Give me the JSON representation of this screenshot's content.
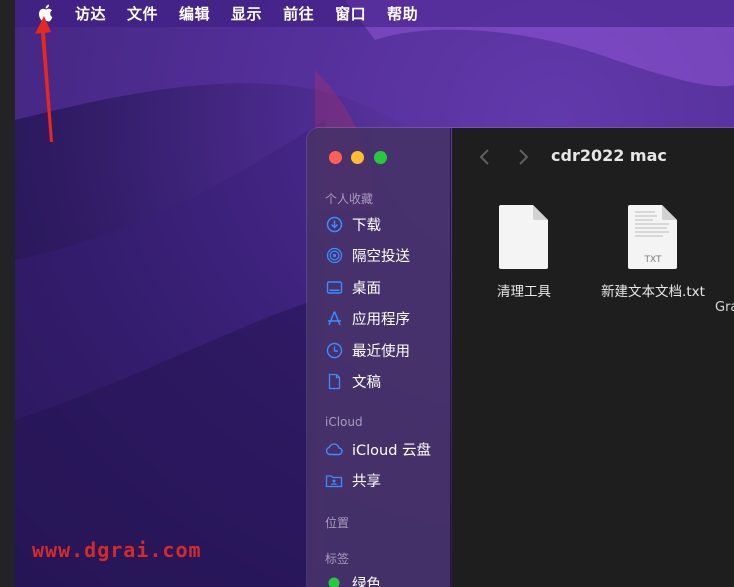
{
  "menubar": {
    "apple_icon": "apple-logo-icon",
    "items": [
      "访达",
      "文件",
      "编辑",
      "显示",
      "前往",
      "窗口",
      "帮助"
    ]
  },
  "finder": {
    "title": "cdr2022 mac",
    "sidebar": {
      "favorites_title": "个人收藏",
      "favorites": [
        {
          "label": "下载",
          "icon": "download-icon"
        },
        {
          "label": "隔空投送",
          "icon": "airdrop-icon"
        },
        {
          "label": "桌面",
          "icon": "desktop-icon"
        },
        {
          "label": "应用程序",
          "icon": "applications-icon"
        },
        {
          "label": "最近使用",
          "icon": "recents-icon"
        },
        {
          "label": "文稿",
          "icon": "document-icon"
        }
      ],
      "icloud_title": "iCloud",
      "icloud": [
        {
          "label": "iCloud 云盘",
          "icon": "cloud-icon"
        },
        {
          "label": "共享",
          "icon": "shared-folder-icon"
        }
      ],
      "locations_title": "位置",
      "tags_title": "标签",
      "tags": [
        {
          "label": "绿色",
          "color": "#28c840"
        }
      ]
    },
    "files": [
      {
        "name": "清理工具",
        "type": "",
        "icon": "blank-document-icon"
      },
      {
        "name": "新建文本文档.txt",
        "type": "TXT",
        "icon": "txt-document-icon"
      }
    ],
    "partial_file_label": "Gra"
  },
  "watermark": "www.dgrai.com",
  "colors": {
    "red": "#ff5f57",
    "yellow": "#febc2e",
    "green": "#28c840",
    "sidebar_icon": "#3d8bff",
    "watermark": "#d42a2a"
  }
}
